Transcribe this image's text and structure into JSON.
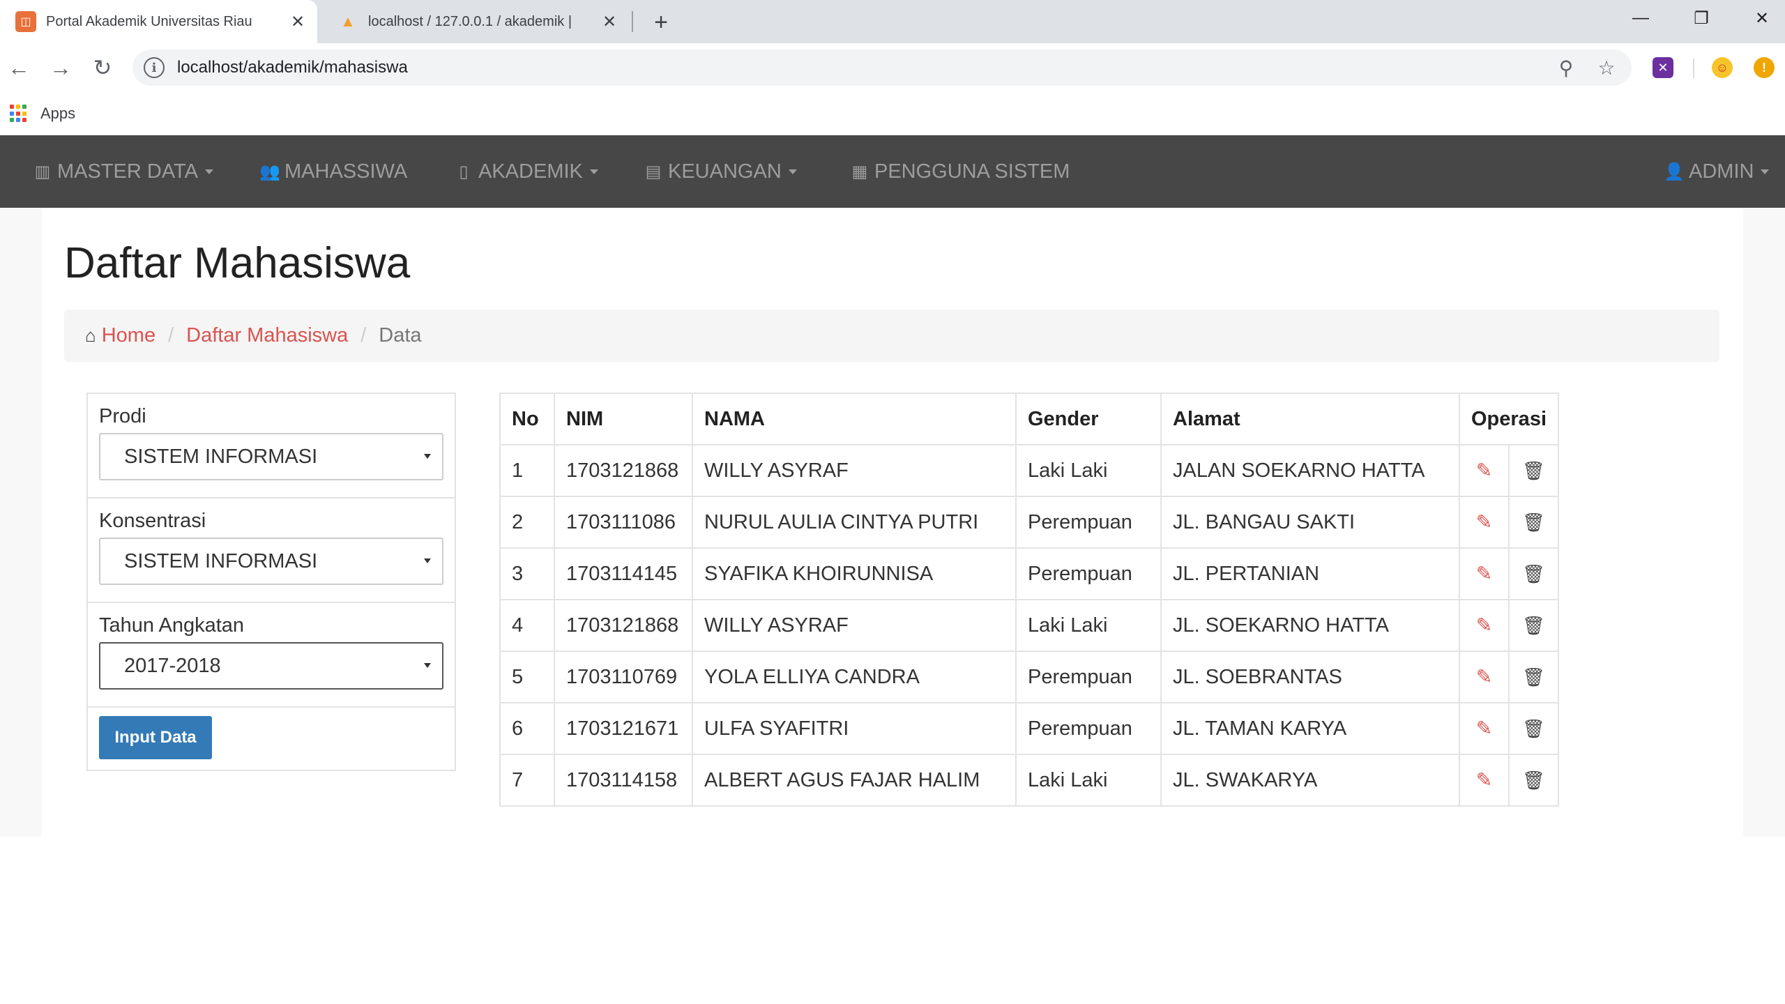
{
  "browser": {
    "tabs": [
      {
        "title": "Portal Akademik Universitas Riau",
        "favicon": "portal-favicon",
        "active": true
      },
      {
        "title": "localhost / 127.0.0.1 / akademik | ",
        "favicon": "phpmyadmin-favicon",
        "active": false
      }
    ],
    "url": "localhost/akademik/mahasiswa",
    "bookmarks": [
      {
        "label": "Apps"
      }
    ],
    "glyphs": {
      "close": "✕",
      "new_tab": "+",
      "minimize": "—",
      "restore": "❐",
      "window_close": "✕",
      "back": "←",
      "forward": "→",
      "reload": "↻",
      "info": "i",
      "zoom": "⚲",
      "star": "☆",
      "ext_purple": "✕",
      "ext_emoji": "☺",
      "ext_alert": "!"
    }
  },
  "navbar": {
    "items": [
      {
        "label": "MASTER DATA",
        "icon": "bar-chart-icon",
        "glyph": "▥",
        "dropdown": true
      },
      {
        "label": "MAHASSIWA",
        "icon": "users-icon",
        "glyph": "👥",
        "dropdown": false
      },
      {
        "label": "AKADEMIK",
        "icon": "book-icon",
        "glyph": "▯",
        "dropdown": true
      },
      {
        "label": "KEUANGAN",
        "icon": "money-icon",
        "glyph": "▤",
        "dropdown": true
      },
      {
        "label": "PENGGUNA SISTEM",
        "icon": "user-list-icon",
        "glyph": "▦",
        "dropdown": false
      }
    ],
    "user": {
      "label": "ADMIN",
      "icon": "user-icon",
      "glyph": "👤",
      "dropdown": true
    }
  },
  "page": {
    "title": "Daftar Mahasiswa",
    "breadcrumb": {
      "home_glyph": "⌂",
      "home": "Home",
      "separator": "/",
      "section": "Daftar Mahasiswa",
      "current": "Data"
    }
  },
  "filters": {
    "prodi": {
      "label": "Prodi",
      "value": "SISTEM INFORMASI"
    },
    "konsentrasi": {
      "label": "Konsentrasi",
      "value": "SISTEM INFORMASI"
    },
    "tahun": {
      "label": "Tahun Angkatan",
      "value": "2017-2018"
    },
    "button": "Input Data"
  },
  "table": {
    "headers": [
      "No",
      "NIM",
      "NAMA",
      "Gender",
      "Alamat",
      "Operasi"
    ],
    "edit_glyph": "✎",
    "trash_glyph": "🗑",
    "rows": [
      {
        "no": "1",
        "nim": "1703121868",
        "nama": "WILLY ASYRAF",
        "gender": "Laki Laki",
        "alamat": "JALAN SOEKARNO HATTA"
      },
      {
        "no": "2",
        "nim": "1703111086",
        "nama": "NURUL AULIA CINTYA PUTRI",
        "gender": "Perempuan",
        "alamat": "JL. BANGAU SAKTI"
      },
      {
        "no": "3",
        "nim": "1703114145",
        "nama": "SYAFIKA KHOIRUNNISA",
        "gender": "Perempuan",
        "alamat": "JL. PERTANIAN"
      },
      {
        "no": "4",
        "nim": "1703121868",
        "nama": "WILLY ASYRAF",
        "gender": "Laki Laki",
        "alamat": "JL. SOEKARNO HATTA"
      },
      {
        "no": "5",
        "nim": "1703110769",
        "nama": "YOLA ELLIYA CANDRA",
        "gender": "Perempuan",
        "alamat": "JL. SOEBRANTAS"
      },
      {
        "no": "6",
        "nim": "1703121671",
        "nama": "ULFA SYAFITRI",
        "gender": "Perempuan",
        "alamat": "JL. TAMAN KARYA"
      },
      {
        "no": "7",
        "nim": "1703114158",
        "nama": "ALBERT AGUS FAJAR HALIM",
        "gender": "Laki Laki",
        "alamat": "JL. SWAKARYA"
      }
    ]
  },
  "colors": {
    "navbar_bg": "#474747",
    "navbar_text": "#9d9d9d",
    "link": "#d9534f",
    "primary_button": "#337ab7"
  }
}
